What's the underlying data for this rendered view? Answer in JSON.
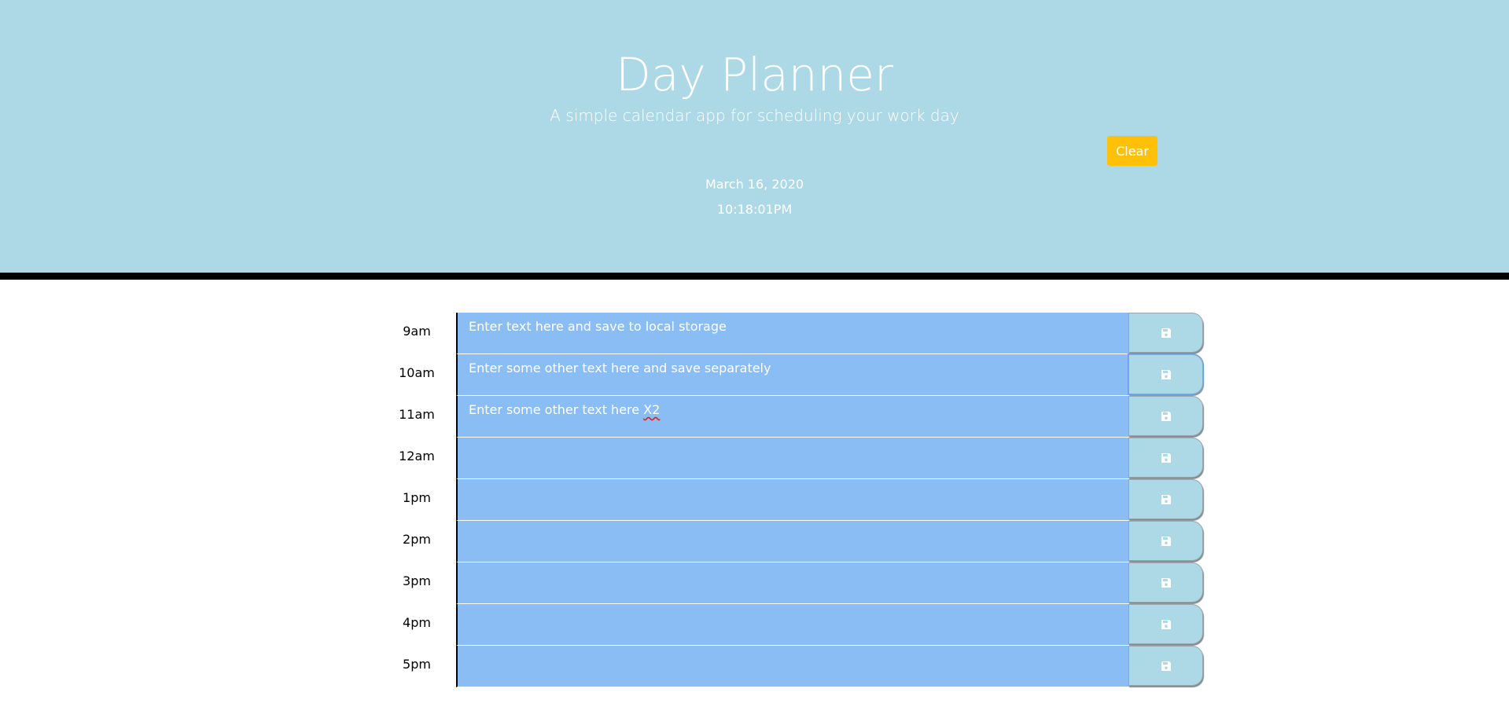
{
  "header": {
    "title": "Day Planner",
    "subtitle": "A simple calendar app for scheduling your work day",
    "clear_label": "Clear",
    "date": "March 16, 2020",
    "time": "10:18:01PM"
  },
  "planner": {
    "rows": [
      {
        "hour": "9am",
        "text": "Enter text here and save to local storage"
      },
      {
        "hour": "10am",
        "text": "Enter some other text here and save separately"
      },
      {
        "hour": "11am",
        "text": "Enter some other text here X2"
      },
      {
        "hour": "12am",
        "text": ""
      },
      {
        "hour": "1pm",
        "text": ""
      },
      {
        "hour": "2pm",
        "text": ""
      },
      {
        "hour": "3pm",
        "text": ""
      },
      {
        "hour": "4pm",
        "text": ""
      },
      {
        "hour": "5pm",
        "text": ""
      }
    ],
    "save_icon": "floppy-disk-icon"
  },
  "colors": {
    "header_bg": "#add8e6",
    "clear_button": "#ffc107",
    "row_bg": "#8bbdf5",
    "save_bg": "#add8e6"
  }
}
